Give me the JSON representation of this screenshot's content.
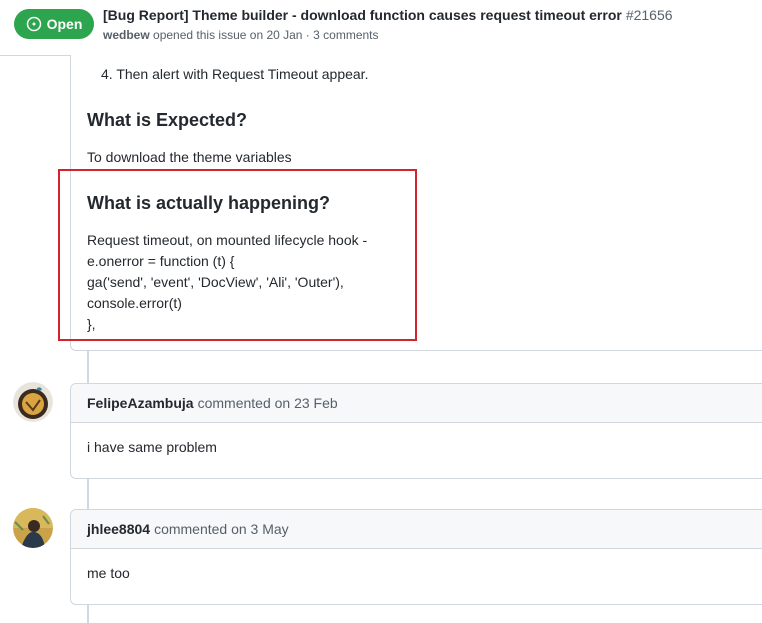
{
  "header": {
    "state": "Open",
    "title": "[Bug Report] Theme builder - download function causes request timeout error",
    "number": "#21656",
    "author": "wedbew",
    "meta_rest": "opened this issue on 20 Jan · 3 comments"
  },
  "body": {
    "step4": "4. Then alert with Request Timeout appear.",
    "expected_heading": "What is Expected?",
    "expected_text": "To download the theme variables",
    "actual_heading": "What is actually happening?",
    "actual_lines": [
      "Request timeout, on mounted lifecycle hook -",
      "e.onerror = function (t) {",
      "ga('send', 'event', 'DocView', 'Ali', 'Outer'),",
      "console.error(t)",
      "},"
    ]
  },
  "comments": [
    {
      "author": "FelipeAzambuja",
      "action": "commented on 23 Feb",
      "text": "i have same problem"
    },
    {
      "author": "jhlee8804",
      "action": "commented on 3 May",
      "text": "me too"
    }
  ],
  "colors": {
    "open_green": "#2da44e",
    "highlight_red": "#d1242f",
    "border": "#d0d7de"
  }
}
